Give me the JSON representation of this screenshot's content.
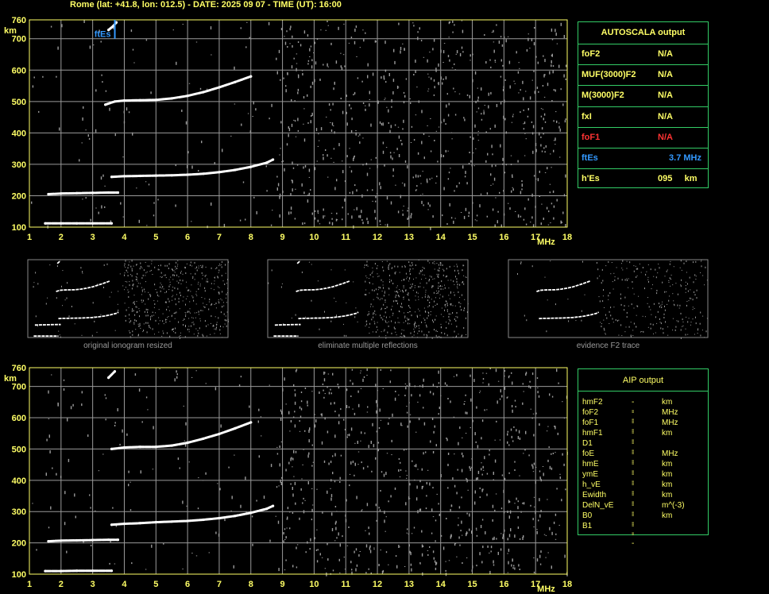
{
  "header": "Rome (lat: +41.8, lon: 012.5) - DATE: 2025 09 07 - TIME (UT): 16:00",
  "colors": {
    "grid": "#9a9a9a",
    "frame": "#ffff66",
    "trace": "#ffffff",
    "label_yellow": "#ffff66",
    "label_red": "#ff3333",
    "label_blue": "#3399ff",
    "table_border": "#33cc66"
  },
  "autoscala": {
    "title": "AUTOSCALA output",
    "rows": [
      {
        "label": "foF2",
        "value": "N/A",
        "color": "#ffff66"
      },
      {
        "label": "MUF(3000)F2",
        "value": "N/A",
        "color": "#ffff66"
      },
      {
        "label": "M(3000)F2",
        "value": "N/A",
        "color": "#ffff66"
      },
      {
        "label": "fxI",
        "value": "N/A",
        "color": "#ffff66"
      },
      {
        "label": "foF1",
        "value": "N/A",
        "color": "#ff3333"
      },
      {
        "label": "ftEs",
        "value": "3.7 MHz",
        "color": "#3399ff"
      },
      {
        "label": "h'Es",
        "value": "095     km",
        "color": "#ffff66"
      }
    ]
  },
  "aip": {
    "title": "AIP output",
    "rows": [
      {
        "param": "hmF2",
        "value": "---",
        "unit": "km"
      },
      {
        "param": "foF2",
        "value": "---",
        "unit": "MHz"
      },
      {
        "param": "foF1",
        "value": "---",
        "unit": "MHz"
      },
      {
        "param": "hmF1",
        "value": "---",
        "unit": "km"
      },
      {
        "param": "D1",
        "value": "---",
        "unit": ""
      },
      {
        "param": "foE",
        "value": "---",
        "unit": "MHz"
      },
      {
        "param": "hmE",
        "value": "---",
        "unit": "km"
      },
      {
        "param": "ymE",
        "value": "---",
        "unit": "km"
      },
      {
        "param": "h_vE",
        "value": "---",
        "unit": "km"
      },
      {
        "param": "Ewidth",
        "value": "---",
        "unit": "km"
      },
      {
        "param": "DelN_vE",
        "value": "---",
        "unit": "m^(-3)"
      },
      {
        "param": "B0",
        "value": "---",
        "unit": "km"
      },
      {
        "param": "B1",
        "value": "---",
        "unit": ""
      }
    ]
  },
  "thumbnails": [
    {
      "caption": "original ionogram resized"
    },
    {
      "caption": "eliminate multiple reflections"
    },
    {
      "caption": "evidence F2 trace"
    }
  ],
  "chart_data": [
    {
      "type": "scatter",
      "title": "",
      "xlabel": "MHz",
      "ylabel": "km",
      "xlim": [
        1,
        18
      ],
      "ylim": [
        100,
        760
      ],
      "x_ticks": [
        1,
        2,
        3,
        4,
        5,
        6,
        7,
        8,
        9,
        10,
        11,
        12,
        13,
        14,
        15,
        16,
        17,
        18
      ],
      "y_ticks": [
        100,
        200,
        300,
        400,
        500,
        600,
        700,
        760
      ],
      "grid": true,
      "annotation": {
        "text": "ftEs",
        "x": 3.7,
        "y_range": [
          700,
          760
        ]
      },
      "series": [
        {
          "points": [
            [
              1.5,
              112
            ],
            [
              2.0,
              112
            ],
            [
              2.5,
              112
            ],
            [
              3.0,
              112
            ],
            [
              3.6,
              112
            ]
          ]
        },
        {
          "points": [
            [
              1.6,
              205
            ],
            [
              2.0,
              207
            ],
            [
              2.5,
              208
            ],
            [
              3.0,
              209
            ],
            [
              3.5,
              210
            ],
            [
              3.8,
              210
            ]
          ]
        },
        {
          "points": [
            [
              3.6,
              260
            ],
            [
              4.0,
              262
            ],
            [
              4.5,
              263
            ],
            [
              5.0,
              264
            ],
            [
              5.5,
              265
            ],
            [
              6.0,
              267
            ],
            [
              6.5,
              270
            ],
            [
              7.0,
              275
            ],
            [
              7.5,
              282
            ],
            [
              8.0,
              292
            ],
            [
              8.5,
              305
            ],
            [
              8.7,
              315
            ]
          ]
        },
        {
          "points": [
            [
              3.4,
              490
            ],
            [
              3.7,
              500
            ],
            [
              4.0,
              503
            ],
            [
              4.5,
              504
            ],
            [
              5.0,
              505
            ],
            [
              5.5,
              510
            ],
            [
              6.0,
              518
            ],
            [
              6.5,
              530
            ],
            [
              7.0,
              545
            ],
            [
              7.5,
              562
            ],
            [
              8.0,
              580
            ]
          ]
        },
        {
          "points": [
            [
              3.5,
              728
            ],
            [
              3.65,
              740
            ],
            [
              3.75,
              752
            ]
          ]
        }
      ]
    },
    {
      "type": "scatter",
      "title": "",
      "xlabel": "MHz",
      "ylabel": "km",
      "xlim": [
        1,
        18
      ],
      "ylim": [
        100,
        760
      ],
      "x_ticks": [
        1,
        2,
        3,
        4,
        5,
        6,
        7,
        8,
        9,
        10,
        11,
        12,
        13,
        14,
        15,
        16,
        17,
        18
      ],
      "y_ticks": [
        100,
        200,
        300,
        400,
        500,
        600,
        700,
        760
      ],
      "grid": true,
      "series": [
        {
          "points": [
            [
              1.5,
              110
            ],
            [
              2.0,
              110
            ],
            [
              2.5,
              111
            ],
            [
              3.0,
              111
            ],
            [
              3.6,
              111
            ]
          ]
        },
        {
          "points": [
            [
              1.6,
              205
            ],
            [
              2.0,
              207
            ],
            [
              2.5,
              208
            ],
            [
              3.0,
              209
            ],
            [
              3.5,
              210
            ],
            [
              3.8,
              210
            ]
          ]
        },
        {
          "points": [
            [
              3.6,
              258
            ],
            [
              4.0,
              261
            ],
            [
              4.5,
              263
            ],
            [
              5.0,
              266
            ],
            [
              5.5,
              268
            ],
            [
              6.0,
              270
            ],
            [
              6.5,
              274
            ],
            [
              7.0,
              279
            ],
            [
              7.5,
              286
            ],
            [
              8.0,
              296
            ],
            [
              8.5,
              309
            ],
            [
              8.7,
              318
            ]
          ]
        },
        {
          "points": [
            [
              3.6,
              500
            ],
            [
              4.0,
              505
            ],
            [
              4.5,
              507
            ],
            [
              5.0,
              507
            ],
            [
              5.5,
              511
            ],
            [
              6.0,
              520
            ],
            [
              6.5,
              533
            ],
            [
              7.0,
              548
            ],
            [
              7.5,
              566
            ],
            [
              8.0,
              585
            ]
          ]
        },
        {
          "points": [
            [
              3.5,
              728
            ],
            [
              3.7,
              748
            ]
          ]
        }
      ]
    }
  ]
}
